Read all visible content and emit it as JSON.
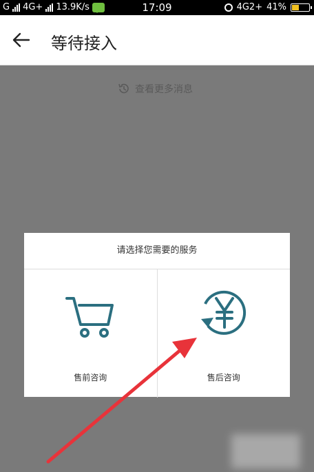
{
  "status_bar": {
    "left_text": "G",
    "network": "4G+",
    "speed": "13.9K/s",
    "time": "17:09",
    "network_right": "4G2+",
    "battery": "41%"
  },
  "header": {
    "title": "等待接入"
  },
  "content": {
    "more_messages": "查看更多消息"
  },
  "dialog": {
    "title": "请选择您需要的服务",
    "options": [
      {
        "label": "售前咨询",
        "icon": "shopping-cart-icon"
      },
      {
        "label": "售后咨询",
        "icon": "refund-yen-icon"
      }
    ]
  },
  "colors": {
    "icon_teal": "#2b6f80",
    "overlay_gray": "#7a7a7a",
    "arrow_red": "#e8333a"
  }
}
